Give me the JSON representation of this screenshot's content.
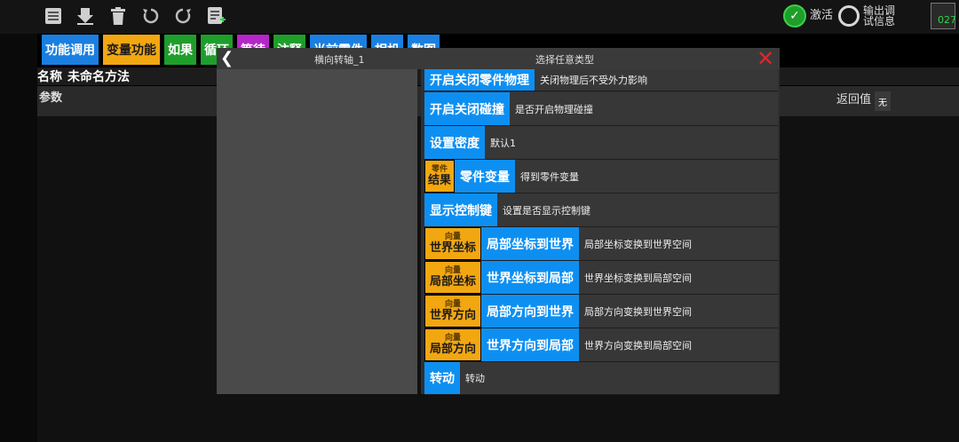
{
  "status": {
    "activate": "激活",
    "output_debug_line1": "输出调",
    "output_debug_line2": "试信息",
    "counter": "027"
  },
  "tabs": [
    {
      "label": "功能调用",
      "bg": "#1a7fe0",
      "fg": "#ffffff"
    },
    {
      "label": "变量功能",
      "bg": "#f2a711",
      "fg": "#1a1a1a"
    },
    {
      "label": "如果",
      "bg": "#1e9e2b",
      "fg": "#ffffff"
    },
    {
      "label": "循环",
      "bg": "#1e9e2b",
      "fg": "#ffffff"
    },
    {
      "label": "等待",
      "bg": "#b526c8",
      "fg": "#ffffff"
    },
    {
      "label": "注释",
      "bg": "#1e9e2b",
      "fg": "#ffffff"
    },
    {
      "label": "当前零件",
      "bg": "#1a7fe0",
      "fg": "#ffffff"
    },
    {
      "label": "相机",
      "bg": "#1a7fe0",
      "fg": "#ffffff"
    },
    {
      "label": "数图",
      "bg": "#1a7fe0",
      "fg": "#ffffff"
    }
  ],
  "method": {
    "name_label": "名称",
    "name_value": "未命名方法",
    "param_label": "参数",
    "return_label": "返回值",
    "return_value": "无"
  },
  "dialog": {
    "left_title": "横向转轴_1",
    "right_title": "选择任意类型"
  },
  "items": [
    {
      "type": "blue",
      "label": "开启关闭零件物理",
      "desc": "关闭物理后不受外力影响"
    },
    {
      "type": "blue",
      "label": "开启关闭碰撞",
      "desc": "是否开启物理碰撞"
    },
    {
      "type": "blue",
      "label": "设置密度",
      "desc": "默认1"
    },
    {
      "type": "combo",
      "tag_top": "零件",
      "tag_main": "结果",
      "label": "零件变量",
      "desc": "得到零件变量"
    },
    {
      "type": "blue",
      "label": "显示控制键",
      "desc": "设置是否显示控制键"
    },
    {
      "type": "combo",
      "tag_top": "向量",
      "tag_main": "世界坐标",
      "label": "局部坐标到世界",
      "desc": "局部坐标变换到世界空间"
    },
    {
      "type": "combo",
      "tag_top": "向量",
      "tag_main": "局部坐标",
      "label": "世界坐标到局部",
      "desc": "世界坐标变换到局部空间"
    },
    {
      "type": "combo",
      "tag_top": "向量",
      "tag_main": "世界方向",
      "label": "局部方向到世界",
      "desc": "局部方向变换到世界空间"
    },
    {
      "type": "combo",
      "tag_top": "向量",
      "tag_main": "局部方向",
      "label": "世界方向到局部",
      "desc": "世界方向变换到局部空间"
    },
    {
      "type": "blue",
      "label": "转动",
      "desc": "转动"
    }
  ],
  "icons": [
    "list-icon",
    "download-icon",
    "trash-icon",
    "undo-icon",
    "redo-icon",
    "add-list-icon"
  ]
}
